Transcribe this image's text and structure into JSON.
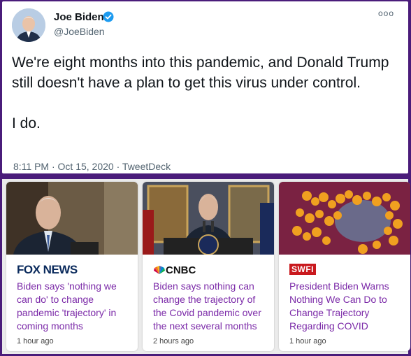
{
  "tweet": {
    "author_name": "Joe Biden",
    "author_handle": "@JoeBiden",
    "more_label": "ooo",
    "paragraphs": [
      "We're eight months into this pandemic, and Donald Trump still doesn't have a plan to get this virus under control.",
      "I do."
    ],
    "timestamp": "8:11 PM · Oct 15, 2020",
    "separator": " · ",
    "source": "TweetDeck"
  },
  "cards": [
    {
      "source": "FOX NEWS",
      "headline": "Biden says 'nothing we can do' to change pandemic 'trajectory' in coming months",
      "time": "1 hour ago"
    },
    {
      "source": "CNBC",
      "headline": "Biden says nothing can change the trajectory of the Covid pandemic over the next several months",
      "time": "2 hours ago"
    },
    {
      "source": "SWFI",
      "headline": "President Biden Warns Nothing We Can Do to Change Trajectory Regarding COVID",
      "time": "1 hour ago"
    }
  ],
  "colors": {
    "frame": "#4a1c7a",
    "headline": "#7b2aa8",
    "verified": "#1d9bf0",
    "fox": "#0a2a5c",
    "swfi": "#c9191e"
  }
}
